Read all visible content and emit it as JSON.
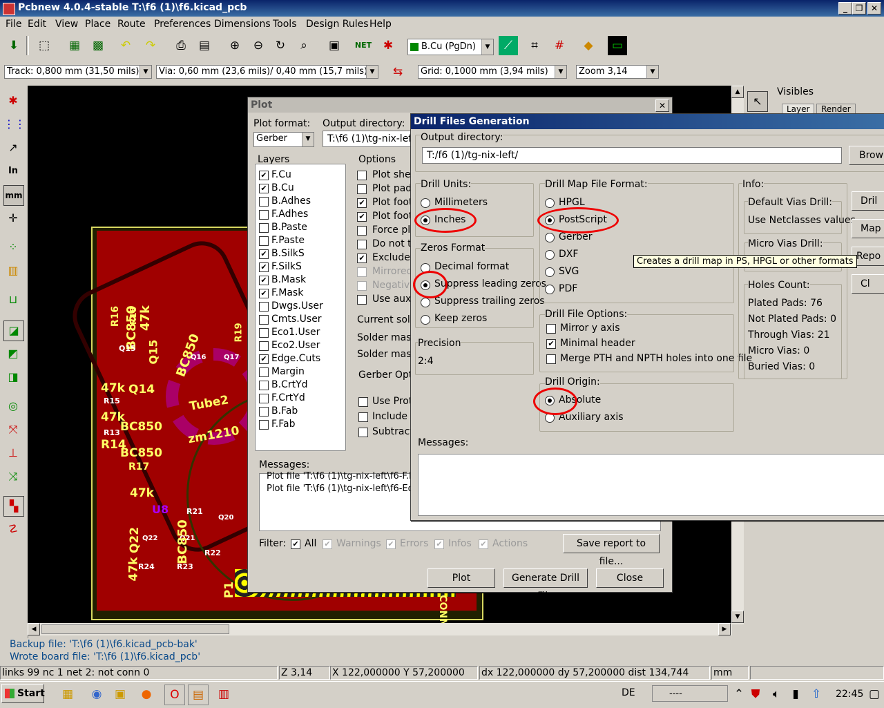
{
  "window": {
    "title": "Pcbnew 4.0.4-stable T:\\f6 (1)\\f6.kicad_pcb"
  },
  "menu": [
    "File",
    "Edit",
    "View",
    "Place",
    "Route",
    "Preferences",
    "Dimensions",
    "Tools",
    "Design Rules",
    "Help"
  ],
  "toolbar": {
    "layer_select": "B.Cu (PgDn)",
    "track": "Track: 0,800 mm (31,50 mils)",
    "via": "Via: 0,60 mm (23,6 mils)/ 0,40 mm (15,7 mils) *",
    "grid": "Grid: 0,1000 mm (3,94 mils)",
    "zoom": "Zoom 3,14"
  },
  "left_toolbar": {
    "units_in": "In",
    "units_mm": "mm"
  },
  "visibles": {
    "title": "Visibles",
    "tabs": [
      "Layer",
      "Render"
    ]
  },
  "plot_dialog": {
    "title": "Plot",
    "plot_format_label": "Plot format:",
    "plot_format": "Gerber",
    "output_dir_label": "Output directory:",
    "output_dir": "T:\\f6 (1)\\tg-nix-left\\",
    "layers_label": "Layers",
    "layers": [
      {
        "name": "F.Cu",
        "checked": true
      },
      {
        "name": "B.Cu",
        "checked": true
      },
      {
        "name": "B.Adhes",
        "checked": false
      },
      {
        "name": "F.Adhes",
        "checked": false
      },
      {
        "name": "B.Paste",
        "checked": false
      },
      {
        "name": "F.Paste",
        "checked": false
      },
      {
        "name": "B.SilkS",
        "checked": true
      },
      {
        "name": "F.SilkS",
        "checked": true
      },
      {
        "name": "B.Mask",
        "checked": true
      },
      {
        "name": "F.Mask",
        "checked": true
      },
      {
        "name": "Dwgs.User",
        "checked": false
      },
      {
        "name": "Cmts.User",
        "checked": false
      },
      {
        "name": "Eco1.User",
        "checked": false
      },
      {
        "name": "Eco2.User",
        "checked": false
      },
      {
        "name": "Edge.Cuts",
        "checked": true
      },
      {
        "name": "Margin",
        "checked": false
      },
      {
        "name": "B.CrtYd",
        "checked": false
      },
      {
        "name": "F.CrtYd",
        "checked": false
      },
      {
        "name": "B.Fab",
        "checked": false
      },
      {
        "name": "F.Fab",
        "checked": false
      }
    ],
    "options_label": "Options",
    "options": [
      {
        "label": "Plot shee",
        "checked": false,
        "disabled": false
      },
      {
        "label": "Plot pads",
        "checked": false,
        "disabled": false
      },
      {
        "label": "Plot foot",
        "checked": true,
        "disabled": false
      },
      {
        "label": "Plot foot",
        "checked": true,
        "disabled": false
      },
      {
        "label": "Force plo",
        "checked": false,
        "disabled": false
      },
      {
        "label": "Do not t",
        "checked": false,
        "disabled": false
      },
      {
        "label": "Exclude",
        "checked": true,
        "disabled": false
      },
      {
        "label": "Mirrored",
        "checked": false,
        "disabled": true
      },
      {
        "label": "Negative",
        "checked": false,
        "disabled": true
      },
      {
        "label": "Use auxil",
        "checked": false,
        "disabled": false
      }
    ],
    "current_solder_label": "Current sold",
    "solder_mask_1": "Solder mask",
    "solder_mask_2": "Solder mask",
    "gerber_options_label": "Gerber Optio",
    "gerber_options": [
      "Use Prot",
      "Include e",
      "Subtract"
    ],
    "messages_label": "Messages:",
    "messages": [
      "Plot file 'T:\\f6 (1)\\tg-nix-left\\f6-F.Mas",
      "Plot file 'T:\\f6 (1)\\tg-nix-left\\f6-Edge.C"
    ],
    "filter_label": "Filter:",
    "filters": [
      {
        "label": "All",
        "disabled": false
      },
      {
        "label": "Warnings",
        "disabled": true
      },
      {
        "label": "Errors",
        "disabled": true
      },
      {
        "label": "Infos",
        "disabled": true
      },
      {
        "label": "Actions",
        "disabled": true
      }
    ],
    "save_report": "Save report to file...",
    "btn_plot": "Plot",
    "btn_drill": "Generate Drill File",
    "btn_close": "Close"
  },
  "drill_dialog": {
    "title": "Drill Files Generation",
    "output_dir_label": "Output directory:",
    "output_dir": "T:/f6 (1)/tg-nix-left/",
    "browse": "Brow",
    "units_label": "Drill Units:",
    "units": [
      {
        "label": "Millimeters",
        "selected": false
      },
      {
        "label": "Inches",
        "selected": true
      }
    ],
    "zeros_label": "Zeros Format",
    "zeros": [
      {
        "label": "Decimal format",
        "selected": false
      },
      {
        "label": "Suppress leading zeros",
        "selected": true
      },
      {
        "label": "Suppress trailing zeros",
        "selected": false
      },
      {
        "label": "Keep zeros",
        "selected": false
      }
    ],
    "precision_label": "Precision",
    "precision": "2:4",
    "map_label": "Drill Map File Format:",
    "map_formats": [
      {
        "label": "HPGL",
        "selected": false
      },
      {
        "label": "PostScript",
        "selected": true
      },
      {
        "label": "Gerber",
        "selected": false
      },
      {
        "label": "DXF",
        "selected": false
      },
      {
        "label": "SVG",
        "selected": false
      },
      {
        "label": "PDF",
        "selected": false
      }
    ],
    "file_options_label": "Drill File Options:",
    "file_options": [
      {
        "label": "Mirror y axis",
        "checked": false
      },
      {
        "label": "Minimal header",
        "checked": true
      },
      {
        "label": "Merge PTH and NPTH holes into one file",
        "checked": false
      }
    ],
    "origin_label": "Drill Origin:",
    "origins": [
      {
        "label": "Absolute",
        "selected": true
      },
      {
        "label": "Auxiliary axis",
        "selected": false
      }
    ],
    "info_label": "Info:",
    "default_vias_label": "Default Vias Drill:",
    "default_vias_value": "Use Netclasses values",
    "micro_vias_label": "Micro Vias Drill:",
    "holes_label": "Holes Count:",
    "holes": [
      "Plated Pads: 76",
      "Not Plated Pads: 0",
      "Through Vias: 21",
      "Micro Vias: 0",
      "Buried Vias: 0"
    ],
    "messages_label": "Messages:",
    "side_buttons": [
      "Dril",
      "Map",
      "Repo",
      "Cl"
    ],
    "tooltip": "Creates a drill map in PS, HPGL or other formats"
  },
  "pcb_labels": {
    "r16": "R16",
    "r18": "R18",
    "bc850a": "BC850",
    "bc850b": "BC850",
    "bc850c": "BC850",
    "bc850d": "BC850",
    "bc850e": "BC850",
    "tube2": "Tube2",
    "zm1210": "zm1210",
    "q14": "Q14",
    "q15": "Q15",
    "q15b": "Q15",
    "r15": "R15",
    "r13": "R13",
    "r17": "R17",
    "r21": "R21",
    "r22": "R22",
    "r23": "R23",
    "r24": "R24",
    "r14": "R14",
    "k47a": "47k",
    "k47b": "47k",
    "k47c": "47k",
    "k47d": "47k",
    "k47e": "47k",
    "q21": "Q21",
    "q22": "Q22",
    "q20": "Q20",
    "q16": "Q16",
    "q17": "Q17",
    "r19": "R19",
    "u8": "U8",
    "p1": "P1",
    "conn": "CONN"
  },
  "message_panel": [
    "Backup file: 'T:\\f6 (1)\\f6.kicad_pcb-bak'",
    "Wrote board file: 'T:\\f6 (1)\\f6.kicad_pcb'"
  ],
  "statusbar": {
    "links": "links 99 nc 1  net 2: not conn 0",
    "zoom": "Z 3,14",
    "xy": "X 122,000000  Y 57,200000",
    "dxy": "dx 122,000000  dy 57,200000  dist 134,744",
    "units": "mm"
  },
  "taskbar": {
    "start": "Start",
    "lang": "DE",
    "tray_text": "----",
    "time": "22:45"
  },
  "colors": {
    "title_start": "#0a246a",
    "title_end": "#3a6ea5",
    "pcb_board": "#a00000",
    "silk": "#ffff66",
    "annotation": "#e00000"
  }
}
